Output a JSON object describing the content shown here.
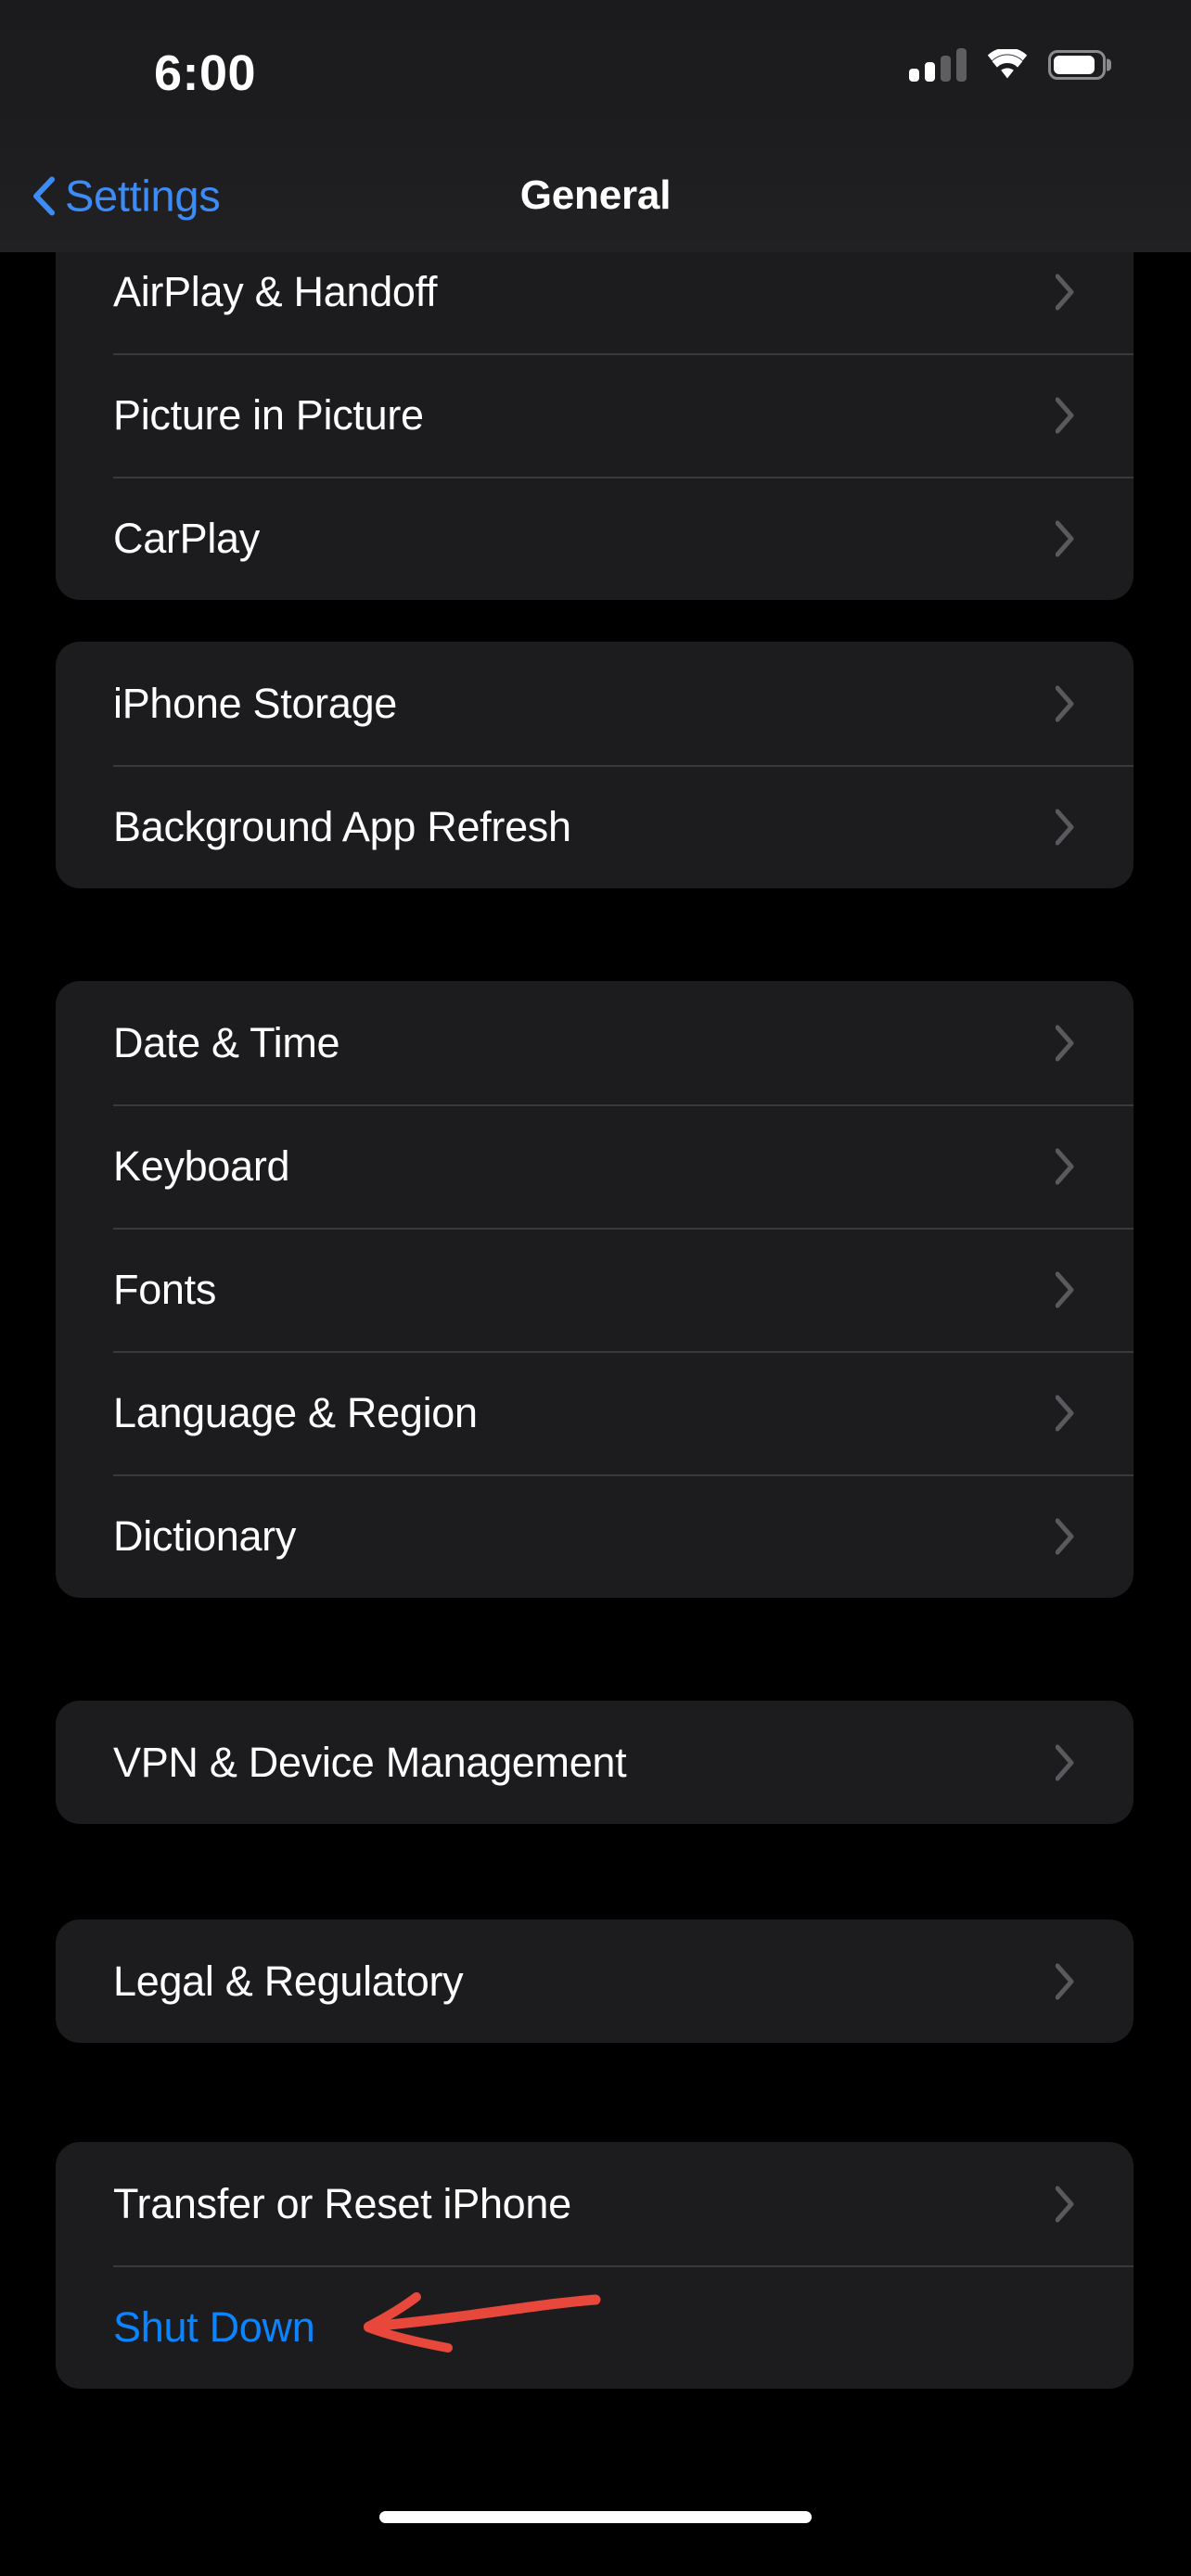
{
  "status_bar": {
    "time": "6:00",
    "cellular_icon": "cellular-signal-icon",
    "cellular_bars_filled": 2,
    "cellular_bars_total": 4,
    "wifi_icon": "wifi-icon",
    "battery_icon": "battery-icon",
    "battery_level_percent": 88
  },
  "nav_bar": {
    "back_label": "Settings",
    "back_icon": "chevron-left-icon",
    "title": "General"
  },
  "groups": [
    {
      "id": "display",
      "clipped_top_row": "AirPlay & Handoff",
      "rows": [
        {
          "label": "AirPlay & Handoff",
          "accent": false,
          "chevron": true
        },
        {
          "label": "Picture in Picture",
          "accent": false,
          "chevron": true
        },
        {
          "label": "CarPlay",
          "accent": false,
          "chevron": true
        }
      ]
    },
    {
      "id": "storage",
      "rows": [
        {
          "label": "iPhone Storage",
          "accent": false,
          "chevron": true
        },
        {
          "label": "Background App Refresh",
          "accent": false,
          "chevron": true
        }
      ]
    },
    {
      "id": "locale",
      "rows": [
        {
          "label": "Date & Time",
          "accent": false,
          "chevron": true
        },
        {
          "label": "Keyboard",
          "accent": false,
          "chevron": true
        },
        {
          "label": "Fonts",
          "accent": false,
          "chevron": true
        },
        {
          "label": "Language & Region",
          "accent": false,
          "chevron": true
        },
        {
          "label": "Dictionary",
          "accent": false,
          "chevron": true
        }
      ]
    },
    {
      "id": "vpn",
      "rows": [
        {
          "label": "VPN & Device Management",
          "accent": false,
          "chevron": true
        }
      ]
    },
    {
      "id": "legal",
      "rows": [
        {
          "label": "Legal & Regulatory",
          "accent": false,
          "chevron": true
        }
      ]
    },
    {
      "id": "reset",
      "rows": [
        {
          "label": "Transfer or Reset iPhone",
          "accent": false,
          "chevron": true
        },
        {
          "label": "Shut Down",
          "accent": true,
          "chevron": false
        }
      ]
    }
  ],
  "annotation": {
    "icon": "red-arrow-annotation",
    "points_at": "Shut Down",
    "color": "#e8483c",
    "direction": "left"
  },
  "home_indicator": "home-indicator",
  "colors": {
    "background": "#000000",
    "card": "#1c1c1e",
    "separator": "#39393b",
    "label": "#ffffff",
    "accent_blue": "#0a84ff",
    "nav_blue": "#3d8bf7",
    "chevron": "#5a5a5e",
    "annotation_red": "#e8483c"
  }
}
